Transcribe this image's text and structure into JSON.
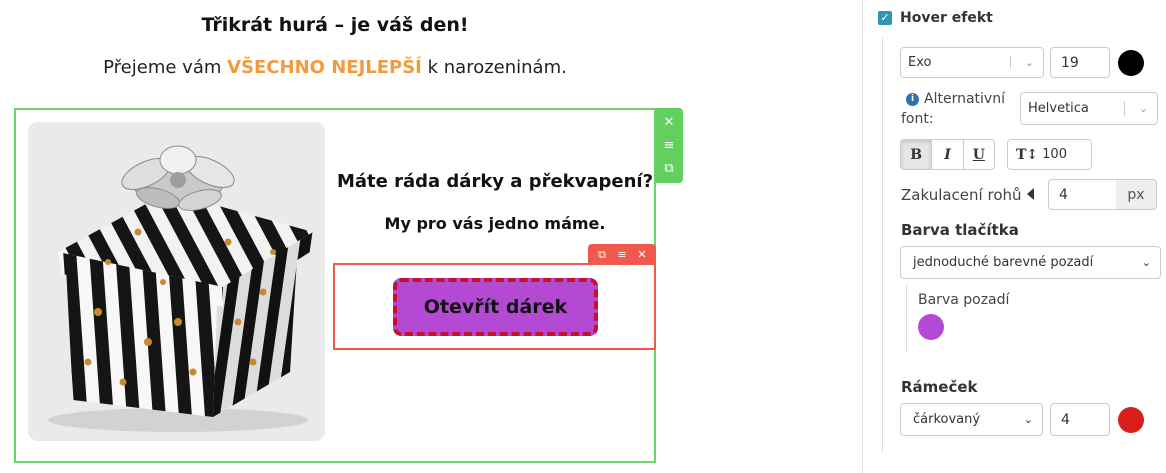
{
  "canvas": {
    "headline": "Třikrát hurá – je váš den!",
    "subline_before": "Přejeme vám ",
    "subline_highlight": "VŠECHNO NEJLEPŠÍ",
    "subline_after": " k narozeninám.",
    "block_tools": {
      "close": "✕",
      "menu": "≡",
      "copy": "⧉"
    },
    "image_alt": "Dárková krabice s pruhy a mašlí",
    "heading": "Máte ráda dárky a překvapení?",
    "subheading": "My pro vás jedno máme.",
    "button_tools": {
      "copy": "⧉",
      "menu": "≡",
      "close": "✕"
    },
    "cta_label": "Otevřít dárek"
  },
  "panel": {
    "hover_label": "Hover efekt",
    "hover_checked": "✓",
    "font_select": "Exo",
    "font_size": "19",
    "font_color": "#000000",
    "alt_font_label_1": "Alternativní",
    "alt_font_label_2": "font:",
    "alt_font_select": "Helvetica",
    "format_bold": "B",
    "format_italic": "I",
    "format_underline": "U",
    "line_height_icon": "T↕",
    "line_height_value": "100",
    "radius_label": "Zakulacení rohů",
    "radius_value": "4",
    "radius_unit": "px",
    "button_color_heading": "Barva tlačítka",
    "bg_type_select": "jednoduché barevné pozadí",
    "bg_color_label": "Barva pozadí",
    "bg_color": "#b44ad4",
    "frame_heading": "Rámeček",
    "frame_style_select": "čárkovaný",
    "frame_width": "4",
    "frame_color": "#d91c1c"
  }
}
